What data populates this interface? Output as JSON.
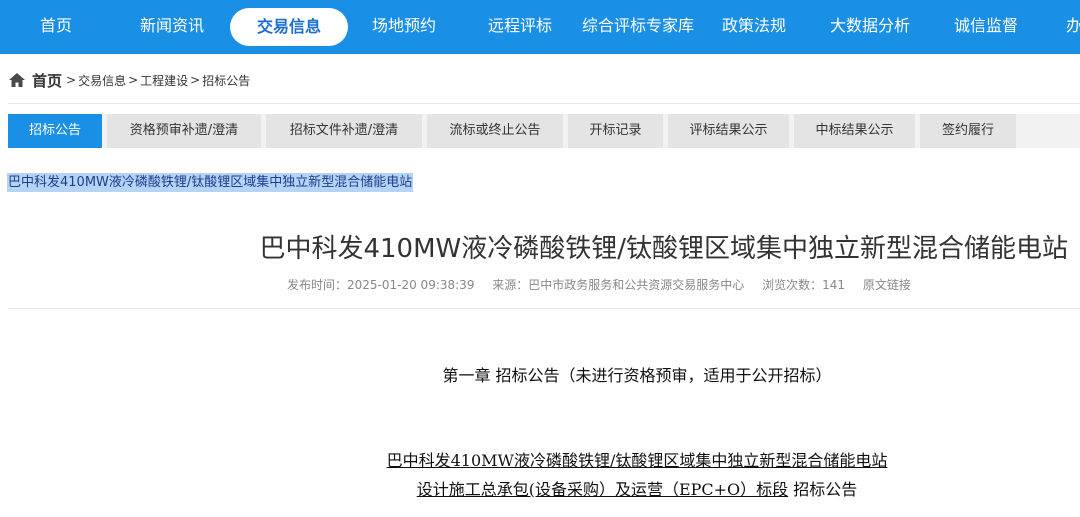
{
  "nav": {
    "items": [
      "首页",
      "新闻资讯",
      "交易信息",
      "场地预约",
      "远程评标",
      "综合评标专家库",
      "政策法规",
      "大数据分析",
      "诚信监督",
      "办"
    ],
    "active_index": 2
  },
  "breadcrumb": {
    "home": "首页",
    "items": [
      "交易信息",
      "工程建设",
      "招标公告"
    ],
    "separator": ">"
  },
  "tabs": {
    "items": [
      "招标公告",
      "资格预审补遗/澄清",
      "招标文件补遗/澄清",
      "流标或终止公告",
      "开标记录",
      "评标结果公示",
      "中标结果公示",
      "签约履行"
    ],
    "active_index": 0
  },
  "selected_title": "巴中科发410MW液冷磷酸铁锂/钛酸锂区域集中独立新型混合储能电站",
  "article": {
    "title": "巴中科发410MW液冷磷酸铁锂/钛酸锂区域集中独立新型混合储能电站",
    "publish_time": "发布时间：2025-01-20 09:38:39",
    "source": "来源：巴中市政务服务和公共资源交易服务中心",
    "views": "浏览次数：141",
    "original_link": "原文链接",
    "chapter": "第一章 招标公告（未进行资格预审，适用于公开招标）",
    "project_line1": "巴中科发410MW液冷磷酸铁锂/钛酸锂区域集中独立新型混合储能电站",
    "project_line2_underlined": "设计施工总承包(设备采购）及运营（EPC+O）标段",
    "project_line2_tail": " 招标公告"
  },
  "colors": {
    "nav_bg": "#1a8fe6",
    "tab_active": "#1a8fe6",
    "selection_bg": "#b5d3f5"
  }
}
